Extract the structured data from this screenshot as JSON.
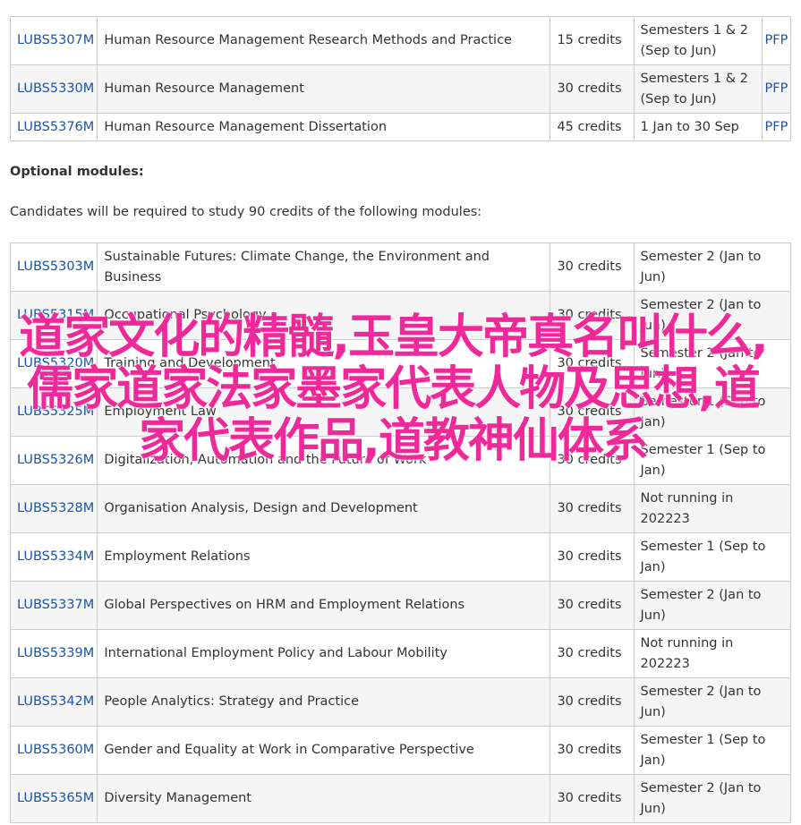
{
  "compulsory_modules": [
    {
      "code": "LUBS5307M",
      "title": "Human Resource Management Research Methods and Practice",
      "credits": "15 credits",
      "semester": "Semesters 1 & 2 (Sep to Jun)",
      "link": "PFP"
    },
    {
      "code": "LUBS5330M",
      "title": "Human Resource Management",
      "credits": "30 credits",
      "semester": "Semesters 1 & 2 (Sep to Jun)",
      "link": "PFP"
    },
    {
      "code": "LUBS5376M",
      "title": "Human Resource Management Dissertation",
      "credits": "45 credits",
      "semester": "1 Jan to 30 Sep",
      "link": "PFP"
    }
  ],
  "optional": {
    "heading": "Optional modules:",
    "intro": "Candidates will be required to study 90 credits of the following modules:"
  },
  "optional_modules": [
    {
      "code": "LUBS5303M",
      "title": "Sustainable Futures: Climate Change, the Environment and Business",
      "credits": "30 credits",
      "semester": "Semester 2 (Jan to Jun)"
    },
    {
      "code": "LUBS5315M",
      "title": "Occupational Psychology",
      "credits": "30 credits",
      "semester": "Semester 2 (Jan to Jun)"
    },
    {
      "code": "LUBS5320M",
      "title": "Training and Development",
      "credits": "30 credits",
      "semester": "Semester 2 (Jan to Jun)"
    },
    {
      "code": "LUBS5325M",
      "title": "Employment Law",
      "credits": "30 credits",
      "semester": "Semester 1 (Sep to Jan)"
    },
    {
      "code": "LUBS5326M",
      "title": "Digitalization, Automation and the Future of Work",
      "credits": "30 credits",
      "semester": "Semester 1 (Sep to Jan)"
    },
    {
      "code": "LUBS5328M",
      "title": "Organisation Analysis, Design and Development",
      "credits": "30 credits",
      "semester": "Not running in 202223"
    },
    {
      "code": "LUBS5334M",
      "title": "Employment Relations",
      "credits": "30 credits",
      "semester": "Semester 1 (Sep to Jan)"
    },
    {
      "code": "LUBS5337M",
      "title": "Global Perspectives on HRM and Employment Relations",
      "credits": "30 credits",
      "semester": "Semester 2 (Jan to Jun)"
    },
    {
      "code": "LUBS5339M",
      "title": "International Employment Policy and Labour Mobility",
      "credits": "30 credits",
      "semester": "Not running in 202223"
    },
    {
      "code": "LUBS5342M",
      "title": "People Analytics: Strategy and Practice",
      "credits": "30 credits",
      "semester": "Semester 2 (Jan to Jun)"
    },
    {
      "code": "LUBS5360M",
      "title": "Gender and Equality at Work in Comparative Perspective",
      "credits": "30 credits",
      "semester": "Semester 1 (Sep to Jan)"
    },
    {
      "code": "LUBS5365M",
      "title": "Diversity Management",
      "credits": "30 credits",
      "semester": "Semester 2 (Jan to Jun)"
    }
  ],
  "overlay": {
    "text": "道家文化的精髓,玉皇大帝真名叫什么,儒家道家法家墨家代表人物及思想,道家代表作品,道教神仙体系"
  },
  "colors": {
    "link": "#1a55a8",
    "overlay": "#f0299a",
    "border": "#cccccc",
    "row_alt": "#f5f5f5"
  }
}
